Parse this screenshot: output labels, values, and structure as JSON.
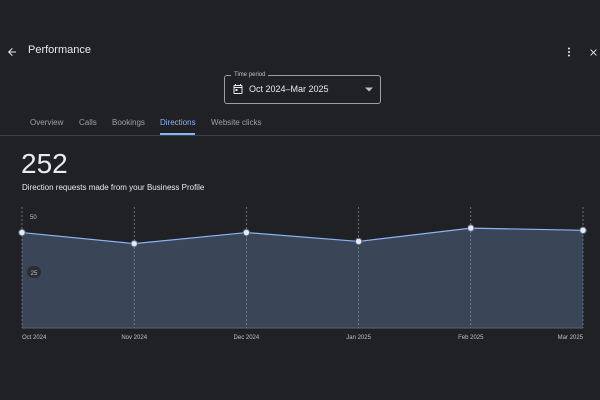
{
  "header": {
    "title": "Performance"
  },
  "period": {
    "legend": "Time period",
    "value": "Oct 2024–Mar 2025"
  },
  "tabs": [
    {
      "label": "Overview"
    },
    {
      "label": "Calls"
    },
    {
      "label": "Bookings"
    },
    {
      "label": "Directions",
      "active": true
    },
    {
      "label": "Website clicks"
    }
  ],
  "summary": {
    "total": "252",
    "description": "Direction requests made from your Business Profile"
  },
  "colors": {
    "accent": "#8ab4f8",
    "background": "#202124",
    "area_fill": "#3a4558",
    "line": "#8ab4f8"
  },
  "icons": {
    "back": "arrow-left-icon",
    "more": "more-vert-icon",
    "close": "close-icon",
    "calendar": "calendar-icon",
    "dropdown": "caret-down-icon"
  },
  "chart_data": {
    "type": "area",
    "categories": [
      "Oct 2024",
      "Nov 2024",
      "Dec 2024",
      "Jan 2025",
      "Feb 2025",
      "Mar 2025"
    ],
    "values": [
      43,
      38,
      43,
      39,
      45,
      44
    ],
    "yticks": [
      "50",
      "25"
    ],
    "ylim": [
      0,
      50
    ],
    "grid": "vertical dashed"
  }
}
